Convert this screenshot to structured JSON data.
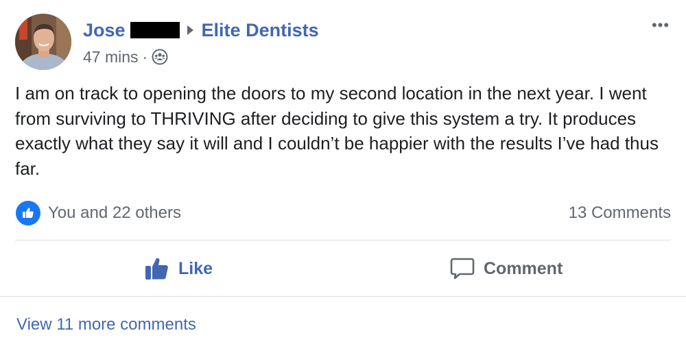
{
  "post": {
    "author_name": "Jose",
    "group_name": "Elite Dentists",
    "time_ago": "47 mins",
    "meta_separator": "·",
    "privacy_icon": "group-icon",
    "more_label": "•••",
    "body_text": "I am on track to opening the doors to my second location in the next year. I went from surviving to THRIVING after deciding to give this system a try. It produces exactly what they say it will and I couldn’t be happier with the results I’ve had thus far."
  },
  "reactions": {
    "icon": "like-icon",
    "summary": "You and 22 others",
    "comments_count": "13 Comments"
  },
  "actions": {
    "like_label": "Like",
    "comment_label": "Comment"
  },
  "comments": {
    "view_more_label": "View 11 more comments"
  },
  "colors": {
    "link_blue": "#4267b2",
    "like_blue": "#1877f2",
    "secondary_gray": "#606770",
    "divider": "#dadde1"
  }
}
